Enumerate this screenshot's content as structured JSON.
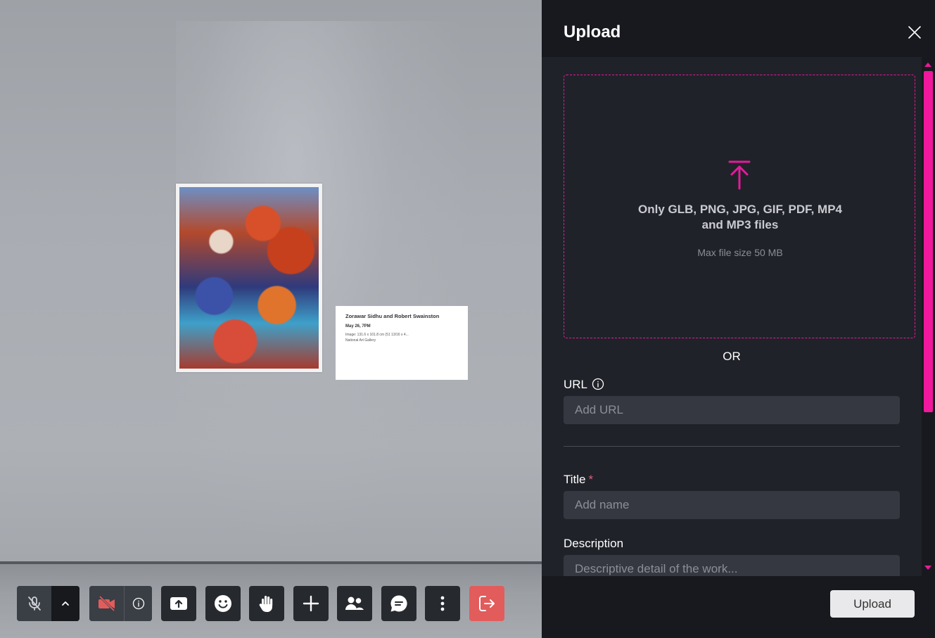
{
  "scene": {
    "placard": {
      "title": "Zorawar Sidhu and Robert Swainston",
      "date": "May 26, 7PM",
      "line1": "Image: 131.6 x 101.8 cm (51 13/16 x 4...",
      "line2": "National Art Gallery"
    }
  },
  "toolbar": {
    "buttons": [
      {
        "name": "mic-off-icon"
      },
      {
        "name": "chevron-up-icon"
      },
      {
        "name": "camera-off-icon"
      },
      {
        "name": "info-icon"
      },
      {
        "name": "share-screen-icon"
      },
      {
        "name": "emoji-icon"
      },
      {
        "name": "raise-hand-icon"
      },
      {
        "name": "plus-icon"
      },
      {
        "name": "people-icon"
      },
      {
        "name": "chat-icon"
      },
      {
        "name": "more-vertical-icon"
      },
      {
        "name": "leave-icon"
      }
    ],
    "colors": {
      "button_bg": "#26292e",
      "leave": "#e25c5c",
      "camera_off": "#e25c5c"
    }
  },
  "panel": {
    "title": "Upload",
    "dropzone": {
      "line1": "Only GLB, PNG, JPG, GIF, PDF, MP4",
      "line2": "and MP3 files",
      "sub": "Max file size 50 MB"
    },
    "or": "OR",
    "url": {
      "label": "URL",
      "placeholder": "Add URL"
    },
    "title_field": {
      "label": "Title",
      "required_mark": "*",
      "placeholder": "Add name"
    },
    "description": {
      "label": "Description",
      "placeholder": "Descriptive detail of the work..."
    },
    "submit": "Upload",
    "accent": "#e41b9b"
  }
}
